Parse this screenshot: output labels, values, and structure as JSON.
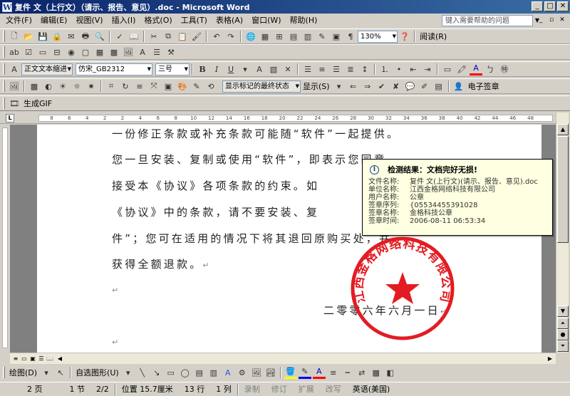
{
  "window": {
    "title": "复件 文（上行文）（请示、报告、意见）.doc - Microsoft Word",
    "icon_letter": "W",
    "minimize_glyph": "_",
    "maximize_glyph": "□",
    "close_glyph": "✕"
  },
  "menu": {
    "items": [
      "文件(F)",
      "编辑(E)",
      "视图(V)",
      "插入(I)",
      "格式(O)",
      "工具(T)",
      "表格(A)",
      "窗口(W)",
      "帮助(H)"
    ],
    "help_placeholder": "键入需要帮助的问题"
  },
  "toolbar_standard": {
    "zoom": "130%",
    "read_label": "阅读(R)"
  },
  "toolbar_format": {
    "style": "正文文本缩进",
    "font": "仿宋_GB2312",
    "size": "三号",
    "bold": "B",
    "italic": "I",
    "underline": "U",
    "font_color_letter": "A"
  },
  "toolbar_review": {
    "markup_state": "显示标记的最终状态",
    "show_label": "显示(S)",
    "esign_label": "电子签章"
  },
  "toolbar_gif": {
    "label": "生成GIF"
  },
  "ruler": {
    "ticks": [
      "8",
      "6",
      "4",
      "2",
      "2",
      "4",
      "6",
      "8",
      "10",
      "12",
      "14",
      "16",
      "18",
      "20",
      "22",
      "24",
      "26",
      "28",
      "30",
      "32",
      "34",
      "36",
      "38",
      "40",
      "42",
      "44",
      "46",
      "48"
    ]
  },
  "document": {
    "lines": [
      "一份修正条款或补充条款可能随“软件”一起提供。",
      "您一旦安装、复制或使用“软件”，即表示您同意",
      "接受本《协议》各项条款的约束。如",
      "《协议》中的条款，请不要安装、复",
      "件”；您可在适用的情况下将其退回原购买处，并",
      "获得全额退款。"
    ],
    "date_line": "二零零六年六月一日",
    "para_mark": "↵"
  },
  "verify_popup": {
    "title": "检测结果：文档完好无损!",
    "rows": [
      {
        "label": "文件名称:",
        "value": "复件 文(上行文)(请示、报告、意见).doc"
      },
      {
        "label": "单位名称:",
        "value": "江西金格网络科技有限公司"
      },
      {
        "label": "用户名称:",
        "value": "公章"
      },
      {
        "label": "签章序列:",
        "value": "{05534455391028"
      },
      {
        "label": "签章名称:",
        "value": "金格科技公章"
      },
      {
        "label": "签章时间:",
        "value": "2006-08-11 06:53:34"
      }
    ]
  },
  "seal": {
    "text": "江西金格网络科技有限公司",
    "color": "#e31c23"
  },
  "drawbar": {
    "draw_label": "绘图(D)",
    "autoshape_label": "自选图形(U)"
  },
  "status": {
    "page": "2 页",
    "section": "1 节",
    "pages": "2/2",
    "position": "位置 15.7厘米",
    "line": "13 行",
    "column": "1 列",
    "rec": "录制",
    "trk": "修订",
    "ext": "扩展",
    "ovr": "改写",
    "language": "英语(美国)"
  }
}
